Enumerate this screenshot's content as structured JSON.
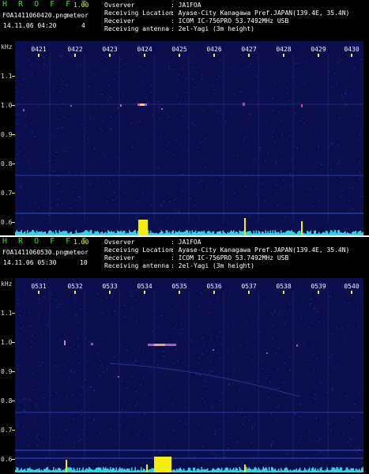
{
  "panels": [
    {
      "app_title": "H R O F F T",
      "version": "1.00",
      "filename": "FOA1411060420.png",
      "datetime": "14.11.06 04:20",
      "meteor_label": "meteor",
      "meteor_count": "4",
      "info": [
        {
          "label": "Ovserver",
          "value": ": JA1FOA"
        },
        {
          "label": "Receiving Location",
          "value": ": Ayase-City Kanagawa Pref.JAPAN(139.4E, 35.4N)"
        },
        {
          "label": "Receiver",
          "value": ": ICOM IC-756PRO 53.7492MHz USB"
        },
        {
          "label": "Receiving antenna",
          "value": ": 2el-Yagi (3m height)"
        }
      ],
      "time_ticks": [
        "0421",
        "0422",
        "0423",
        "0424",
        "0425",
        "0426",
        "0427",
        "0428",
        "0429",
        "0430"
      ],
      "freq_unit": "kHz",
      "freq_ticks": [
        "1.1",
        "1.0",
        "0.9",
        "0.8",
        "0.7",
        "0.6"
      ]
    },
    {
      "app_title": "H R O F F T",
      "version": "1.00",
      "filename": "FOA1411060530.png",
      "datetime": "14.11.06 05:30",
      "meteor_label": "meteor",
      "meteor_count": "10",
      "info": [
        {
          "label": "Ovserver",
          "value": ": JA1FOA"
        },
        {
          "label": "Receiving Location",
          "value": ": Ayase-City Kanagawa Pref.JAPAN(139.4E, 35.4N)"
        },
        {
          "label": "Receiver",
          "value": ": ICOM IC-756PRO 53.7492MHz USB"
        },
        {
          "label": "Receiving antenna",
          "value": ": 2el-Yagi (3m height)"
        }
      ],
      "time_ticks": [
        "0531",
        "0532",
        "0533",
        "0534",
        "0535",
        "0536",
        "0537",
        "0538",
        "0539",
        "0540"
      ],
      "freq_unit": "kHz",
      "freq_ticks": [
        "1.1",
        "1.0",
        "0.9",
        "0.8",
        "0.7",
        "0.6"
      ]
    }
  ],
  "colors": {
    "background": "#0b0f4e",
    "title_green": "#39e51f",
    "tick_yellow": "#e8e85a",
    "signal_cyan": "#2ad7e8",
    "meteor_yellow": "#f4f000"
  }
}
